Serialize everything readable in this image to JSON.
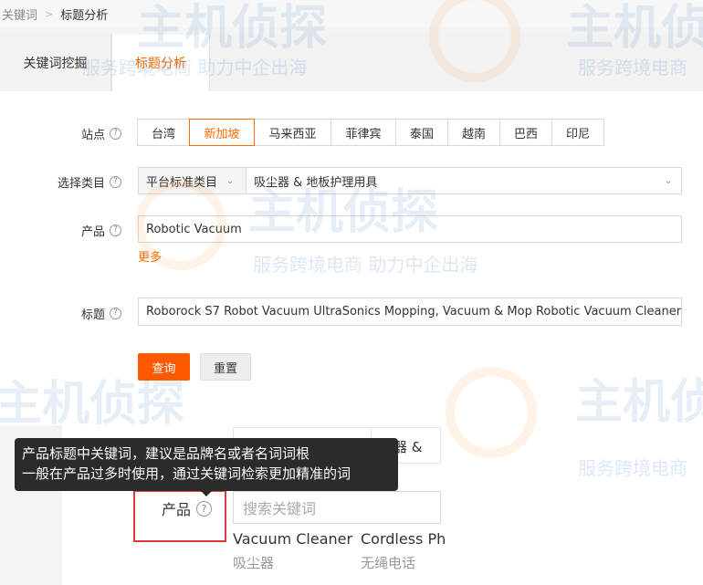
{
  "breadcrumb": {
    "parent": "关键词",
    "current": "标题分析"
  },
  "tabs": [
    {
      "label": "关键词挖掘"
    },
    {
      "label": "标题分析"
    }
  ],
  "form": {
    "site": {
      "label": "站点",
      "options": [
        "台湾",
        "新加坡",
        "马来西亚",
        "菲律宾",
        "泰国",
        "越南",
        "巴西",
        "印尼"
      ],
      "selected": "新加坡"
    },
    "category": {
      "label": "选择类目",
      "type_value": "平台标准类目",
      "value": "吸尘器 & 地板护理用具"
    },
    "product": {
      "label": "产品",
      "value": "Robotic Vacuum",
      "more_link": "更多"
    },
    "title": {
      "label": "标题",
      "value": "Roborock S7 Robot Vacuum UltraSonics Mopping, Vacuum & Mop Robotic Vacuum Cleaner"
    },
    "query_button": "查询",
    "reset_button": "重置"
  },
  "popup": {
    "partial_category": "尘器 &",
    "product_label": "产品",
    "search_placeholder": "搜索关键词",
    "keywords": [
      {
        "en": "Vacuum Cleaner",
        "zh": "吸尘器"
      },
      {
        "en": "Cordless Ph",
        "zh": "无绳电话"
      }
    ]
  },
  "tooltip": {
    "line1": "产品标题中关键词，建议是品牌名或者名词词根",
    "line2": "一般在产品过多时使用，通过关键词检索更加精准的词"
  },
  "watermark": {
    "brand": "主机侦探",
    "slogan": "服务跨境电商 助力中企出海",
    "slogan_short": "服务跨境电商"
  },
  "colors": {
    "accent": "#ff6a00",
    "button": "#ff5a00",
    "highlight_box": "#e03a3a",
    "tooltip_bg": "#2b2b2b"
  }
}
